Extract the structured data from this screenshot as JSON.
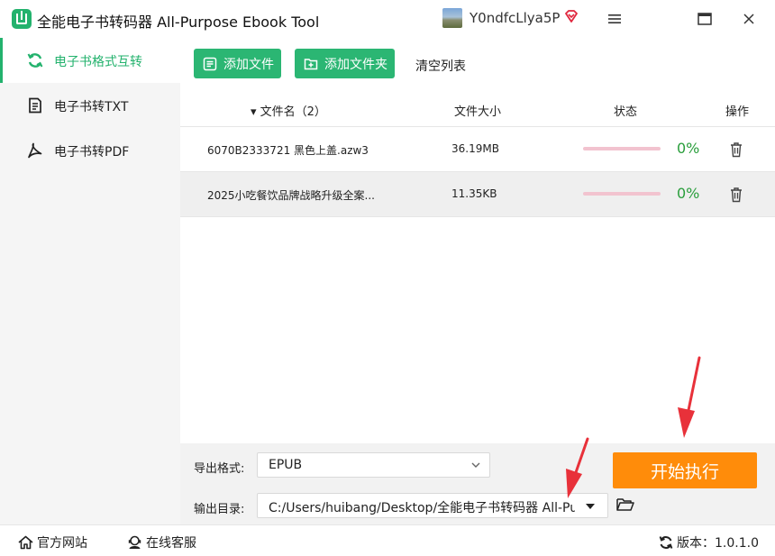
{
  "app": {
    "title": "全能电子书转码器 All-Purpose Ebook Tool",
    "username": "Y0ndfcLlya5P",
    "icons": [
      "app-logo-icon",
      "vip-diamond-icon",
      "menu-icon",
      "maximize-icon",
      "close-icon"
    ],
    "accent": "#23b26d",
    "orange": "#ff8c0a"
  },
  "sidebar": {
    "items": [
      {
        "label": "电子书格式互转",
        "icon": "refresh-icon",
        "active": true
      },
      {
        "label": "电子书转TXT",
        "icon": "txt-document-icon",
        "active": false
      },
      {
        "label": "电子书转PDF",
        "icon": "pdf-icon",
        "active": false
      }
    ]
  },
  "toolbar": {
    "add_file": "添加文件",
    "add_folder": "添加文件夹",
    "clear_list": "清空列表"
  },
  "table": {
    "headers": {
      "name": "▾ 文件名（2）",
      "size": "文件大小",
      "status": "状态",
      "op": "操作"
    },
    "rows": [
      {
        "name": "6070B2333721 黑色上盖.azw3",
        "size": "36.19MB",
        "progress": 0,
        "percent": "0%"
      },
      {
        "name": "2025小吃餐饮品牌战略升级全案...",
        "size": "11.35KB",
        "progress": 0,
        "percent": "0%"
      }
    ]
  },
  "output": {
    "format_label": "导出格式:",
    "format_value": "EPUB",
    "dir_label": "输出目录:",
    "dir_value": "C:/Users/huibang/Desktop/全能电子书转码器 All-Purpose Ebook Tool",
    "start_button": "开始执行"
  },
  "statusbar": {
    "website": "官方网站",
    "service": "在线客服",
    "version": "版本：1.0.1.0"
  }
}
